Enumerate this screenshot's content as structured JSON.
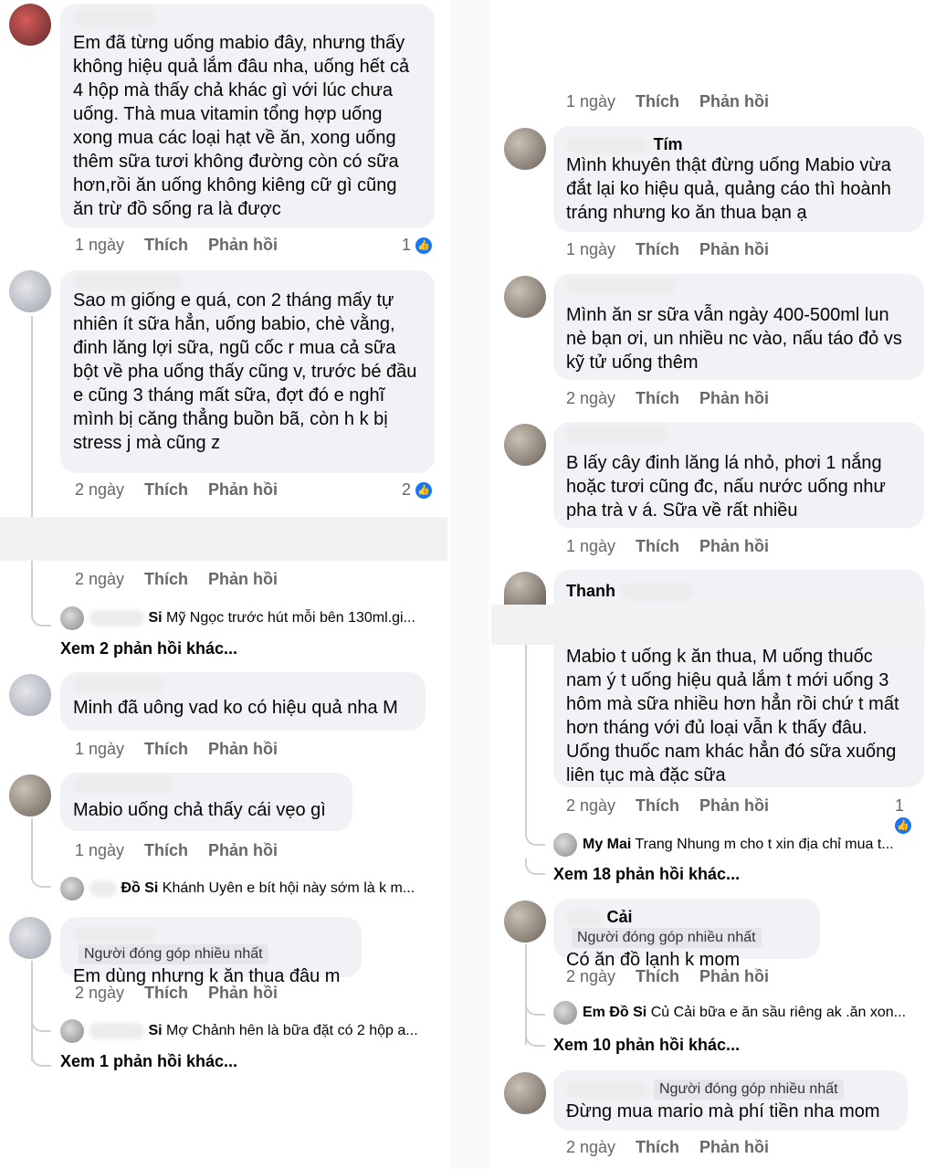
{
  "left": {
    "c1": {
      "text": "Em đã từng uống mabio đây, nhưng thấy không hiệu quả lắm đâu nha, uống hết cả 4 hộp mà thấy chả khác gì với lúc chưa uống. Thà mua vitamin tổng hợp uống xong mua các loại hạt về ăn, xong uống thêm sữa tươi không đường còn có sữa hơn,rồi ăn uống không kiêng cữ gì cũng ăn trừ đồ sống ra là được",
      "time": "1 ngày",
      "like": "Thích",
      "reply": "Phản hồi",
      "likes": "1"
    },
    "c2": {
      "text": "Sao m giống e quá, con 2 tháng mấy tự nhiên ít sữa hẳn, uống babio, chè vằng, đinh lăng lợi sữa, ngũ cốc r mua cả sữa bột về pha uống thấy cũng v, trước bé đầu e cũng 3 tháng mất sữa, đợt đó e nghĩ mình bị căng thẳng buồn bã, còn h k bị stress j mà cũng z",
      "time": "2 ngày",
      "like": "Thích",
      "reply": "Phản hồi",
      "likes": "2"
    },
    "c3": {
      "time": "2 ngày",
      "like": "Thích",
      "reply": "Phản hồi",
      "reply_name": "Si",
      "reply_text": "Mỹ Ngọc trước hút mỗi bên 130ml.gi...",
      "more": "Xem 2 phản hồi khác..."
    },
    "c4": {
      "text": "Minh đã uông vad ko có hiệu quả nha M",
      "time": "1 ngày",
      "like": "Thích",
      "reply": "Phản hồi"
    },
    "c5": {
      "text": "Mabio uống chả thấy cái vẹo gì",
      "time": "1 ngày",
      "like": "Thích",
      "reply": "Phản hồi",
      "reply_name": "Đồ Si",
      "reply_text": "Khánh Uyên e bít hội này sớm là k m..."
    },
    "c6": {
      "badge": "Người đóng góp nhiều nhất",
      "text": "Em dùng nhưng k ăn thua đâu m",
      "time": "2 ngày",
      "like": "Thích",
      "reply": "Phản hồi",
      "reply_name": "Si",
      "reply_text": "Mợ Chảnh hên là bữa đặt có 2 hộp a...",
      "more": "Xem 1 phản hồi khác..."
    }
  },
  "right": {
    "r0": {
      "time": "1 ngày",
      "like": "Thích",
      "reply": "Phản hồi"
    },
    "r1": {
      "name": "Tím",
      "text": "Mình khuyên thật đừng uống Mabio vừa đắt lại ko hiệu quả, quảng cáo thì hoành tráng nhưng ko ăn thua bạn ạ",
      "time": "1 ngày",
      "like": "Thích",
      "reply": "Phản hồi"
    },
    "r2": {
      "text": "Mình ăn sr sữa vẫn ngày 400-500ml lun nè bạn ơi, un nhiều nc vào, nấu táo đỏ vs kỹ tử uống thêm",
      "time": "2 ngày",
      "like": "Thích",
      "reply": "Phản hồi"
    },
    "r3": {
      "text": "B lấy cây đinh lăng lá nhỏ, phơi 1 nắng hoặc tươi cũng đc, nấu nước uống như pha trà v á. Sữa về rất nhiều",
      "time": "1 ngày",
      "like": "Thích",
      "reply": "Phản hồi"
    },
    "r4": {
      "name": "Thanh"
    },
    "r5": {
      "text": "Mabio t uống k ăn thua, M uống thuốc nam ý t uống hiệu quả lắm t mới uống 3 hôm mà sữa nhiều hơn hẳn rồi chứ t mất hơn tháng với đủ loại vẫn k thấy đâu. Uống thuốc nam khác hẳn đó sữa xuống liên tục mà đặc sữa",
      "time": "2 ngày",
      "like": "Thích",
      "reply": "Phản hồi",
      "likes": "1",
      "reply_name": "My Mai",
      "reply_text": "Trang Nhung m cho t xin địa chỉ mua t...",
      "more": "Xem 18 phản hồi khác..."
    },
    "r6": {
      "name": "Cải",
      "badge": "Người đóng góp nhiều nhất",
      "text": "Có ăn đồ lạnh k mom",
      "time": "2 ngày",
      "like": "Thích",
      "reply": "Phản hồi",
      "reply_name": "Em Đồ Si",
      "reply_text": "Củ Cải bữa e ăn sầu riêng ak .ăn xon...",
      "more": "Xem 10 phản hồi khác..."
    },
    "r7": {
      "badge": "Người đóng góp nhiều nhất",
      "text": "Đừng mua mario mà phí tiền nha mom",
      "time": "2 ngày",
      "like": "Thích",
      "reply": "Phản hồi"
    }
  }
}
